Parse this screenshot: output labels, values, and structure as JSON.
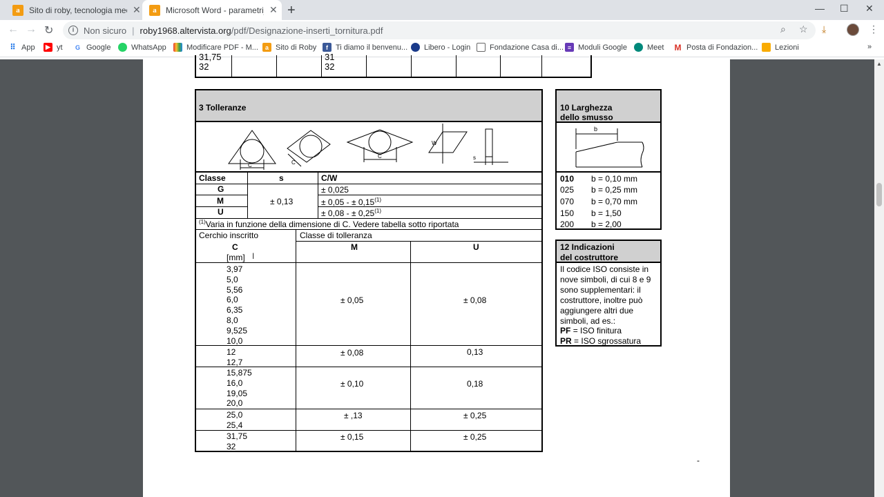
{
  "browser": {
    "tabs": [
      {
        "title": "Sito di roby, tecnologia meccanic",
        "close": "✕"
      },
      {
        "title": "Microsoft Word - parametri_inse",
        "close": "✕"
      }
    ],
    "new_tab": "+",
    "address": {
      "security": "Non sicuro",
      "host": "roby1968.altervista.org",
      "path": "/pdf/Designazione-inserti_tornitura.pdf"
    },
    "bookmarks": [
      "App",
      "yt",
      "Google",
      "WhatsApp",
      "Modificare PDF - M...",
      "Sito di Roby",
      "Ti diamo il benvenu...",
      "Libero - Login",
      "Fondazione Casa di...",
      "Moduli Google",
      "Meet",
      "Posta di Fondazion...",
      "Lezioni"
    ],
    "more": "»"
  },
  "doc": {
    "top_table": {
      "left_vals": [
        "31,75",
        "32"
      ],
      "mid_vals": [
        "31",
        "32"
      ]
    },
    "tolleranze": {
      "title": "3  Tolleranze",
      "shape_labels": {
        "c": "C",
        "w": "W",
        "s": "s"
      },
      "col_classe": "Classe",
      "col_s": "s",
      "col_cw": "C/W",
      "rows": [
        {
          "classe": "G",
          "cw": "± 0,025",
          "sup": ""
        },
        {
          "classe": "M",
          "cw": "± 0,05 - ± 0,15",
          "sup": "(1)"
        },
        {
          "classe": "U",
          "cw": "± 0,08 - ± 0,25",
          "sup": "(1)"
        }
      ],
      "s_value": "± 0,13",
      "note_sup": "(1)",
      "note": "Varia in funzione della dimensione di C. Vedere tabella sotto riportata",
      "cerchio_label": "Cerchio inscritto",
      "classe_toll_label": "Classe di tolleranza",
      "c_head": "C",
      "c_unit": "[mm]",
      "m_head": "M",
      "u_head": "U",
      "groups": [
        {
          "c": [
            "3,97",
            "5,0",
            "5,56",
            "6,0",
            "6,35",
            "8,0",
            "9,525",
            "10,0"
          ],
          "m": "± 0,05",
          "u": "± 0,08"
        },
        {
          "c": [
            "12",
            "12,7"
          ],
          "m": "± 0,08",
          "u": "0,13"
        },
        {
          "c": [
            "15,875",
            "16,0",
            "19,05",
            "20,0"
          ],
          "m": "± 0,10",
          "u": "0,18"
        },
        {
          "c": [
            "25,0",
            "25,4"
          ],
          "m": "± ,13",
          "u": "± 0,25"
        },
        {
          "c": [
            "31,75",
            "32"
          ],
          "m": "± 0,15",
          "u": "± 0,25"
        }
      ]
    },
    "larghezza": {
      "title1": "10  Larghezza",
      "title2": "dello smusso",
      "b_label": "b",
      "rows": [
        {
          "code": "010",
          "val": "b = 0,10 mm",
          "bold": true
        },
        {
          "code": "025",
          "val": "b = 0,25 mm",
          "bold": false
        },
        {
          "code": "070",
          "val": "b = 0,70 mm",
          "bold": false
        },
        {
          "code": "150",
          "val": "b = 1,50",
          "bold": false
        },
        {
          "code": "200",
          "val": "b = 2,00",
          "bold": false
        }
      ]
    },
    "indicazioni": {
      "title1": "12  Indicazioni",
      "title2": "del costruttore",
      "lines": [
        "Il codice ISO consiste in",
        "nove simboli, di cui 8 e 9",
        "sono supplementari: il",
        "costruttore, inoltre può",
        "aggiungere altri due",
        "simboli, ad es.:"
      ],
      "pf_code": "PF",
      "pf_text": "= ISO finitura",
      "pr_code": "PR",
      "pr_text": "= ISO sgrossatura"
    },
    "page_mark": "-"
  }
}
